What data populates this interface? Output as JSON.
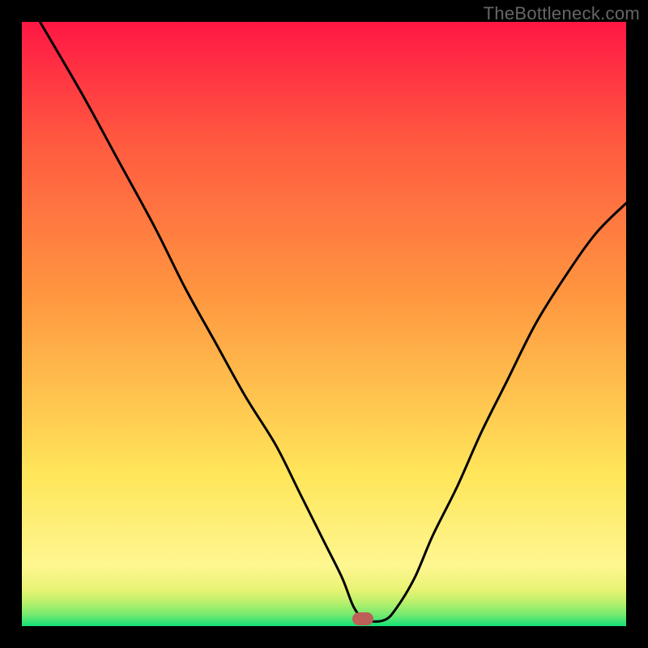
{
  "attribution": "TheBottleneck.com",
  "colors": {
    "band_green": "#12e279",
    "band_1": "#7aea6e",
    "band_2": "#baf06c",
    "band_3": "#e8f373",
    "band_4": "#fef691",
    "grad_yellow": "#ffe65a",
    "grad_orange": "#ff9640",
    "grad_red_orange": "#ff5a40",
    "grad_red": "#ff1744",
    "curve": "#000000",
    "marker": "#bd6058",
    "frame": "#000000"
  },
  "chart_data": {
    "type": "line",
    "title": "",
    "xlabel": "",
    "ylabel": "",
    "xlim": [
      0,
      100
    ],
    "ylim": [
      0,
      100
    ],
    "notes": "V-shaped bottleneck curve; minimum (optimal balance) at x≈56. Background gradient runs green (low values, bottom) to red (high values, top). Values estimated from pixel positions — chart has no numeric labels.",
    "series": [
      {
        "name": "curve",
        "x": [
          3,
          10,
          16,
          22,
          27,
          32,
          37,
          42,
          46,
          50,
          53,
          55,
          57,
          60,
          62,
          65,
          68,
          72,
          76,
          80,
          85,
          90,
          95,
          100
        ],
        "y": [
          100,
          88,
          77,
          66,
          56,
          47,
          38,
          30,
          22,
          14,
          8,
          3,
          1,
          1,
          3,
          8,
          15,
          23,
          32,
          40,
          50,
          58,
          65,
          70
        ]
      }
    ],
    "marker": {
      "x": 56.5,
      "y": 1.2
    },
    "background_gradient_stops": [
      {
        "pos": 0.0,
        "color": "#12e279"
      },
      {
        "pos": 0.02,
        "color": "#7aea6e"
      },
      {
        "pos": 0.04,
        "color": "#baf06c"
      },
      {
        "pos": 0.06,
        "color": "#e8f373"
      },
      {
        "pos": 0.1,
        "color": "#fef691"
      },
      {
        "pos": 0.25,
        "color": "#ffe65a"
      },
      {
        "pos": 0.55,
        "color": "#ff9640"
      },
      {
        "pos": 0.8,
        "color": "#ff5a40"
      },
      {
        "pos": 1.0,
        "color": "#ff1744"
      }
    ]
  }
}
